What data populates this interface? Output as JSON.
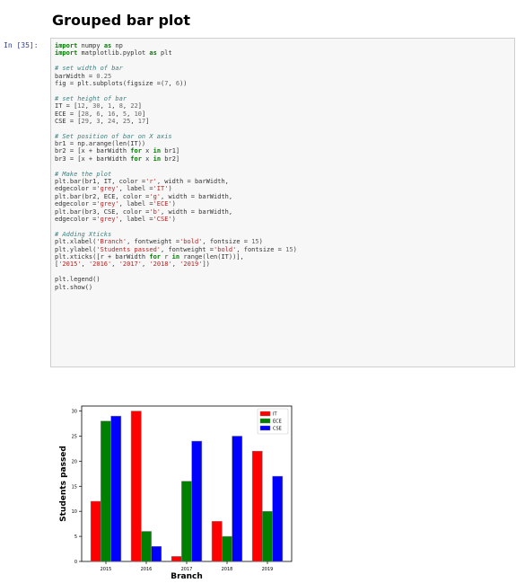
{
  "heading": "Grouped bar plot",
  "cell_prompt": "In [35]:",
  "code_lines": [
    "import numpy as np",
    "import matplotlib.pyplot as plt",
    "",
    "# set width of bar",
    "barWidth = 0.25",
    "fig = plt.subplots(figsize =(7, 6))",
    "",
    "# set height of bar",
    "IT = [12, 30, 1, 8, 22]",
    "ECE = [28, 6, 16, 5, 10]",
    "CSE = [29, 3, 24, 25, 17]",
    "",
    "# Set position of bar on X axis",
    "br1 = np.arange(len(IT))",
    "br2 = [x + barWidth for x in br1]",
    "br3 = [x + barWidth for x in br2]",
    "",
    "# Make the plot",
    "plt.bar(br1, IT, color ='r', width = barWidth,",
    "edgecolor ='grey', label ='IT')",
    "plt.bar(br2, ECE, color ='g', width = barWidth,",
    "edgecolor ='grey', label ='ECE')",
    "plt.bar(br3, CSE, color ='b', width = barWidth,",
    "edgecolor ='grey', label ='CSE')",
    "",
    "# Adding Xticks",
    "plt.xlabel('Branch', fontweight ='bold', fontsize = 15)",
    "plt.ylabel('Students passed', fontweight ='bold', fontsize = 15)",
    "plt.xticks([r + barWidth for r in range(len(IT))],",
    "['2015', '2016', '2017', '2018', '2019'])",
    "",
    "plt.legend()",
    "plt.show()"
  ],
  "chart_data": {
    "type": "bar",
    "categories": [
      "2015",
      "2016",
      "2017",
      "2018",
      "2019"
    ],
    "series": [
      {
        "name": "IT",
        "values": [
          12,
          30,
          1,
          8,
          22
        ],
        "color": "#ff0000"
      },
      {
        "name": "ECE",
        "values": [
          28,
          6,
          16,
          5,
          10
        ],
        "color": "#008000"
      },
      {
        "name": "CSE",
        "values": [
          29,
          3,
          24,
          25,
          17
        ],
        "color": "#0000ff"
      }
    ],
    "xlabel": "Branch",
    "ylabel": "Students passed",
    "ylim": [
      0,
      31
    ],
    "yticks": [
      0,
      5,
      10,
      15,
      20,
      25,
      30
    ],
    "legend_position": "top-right",
    "edgecolor": "#808080"
  }
}
